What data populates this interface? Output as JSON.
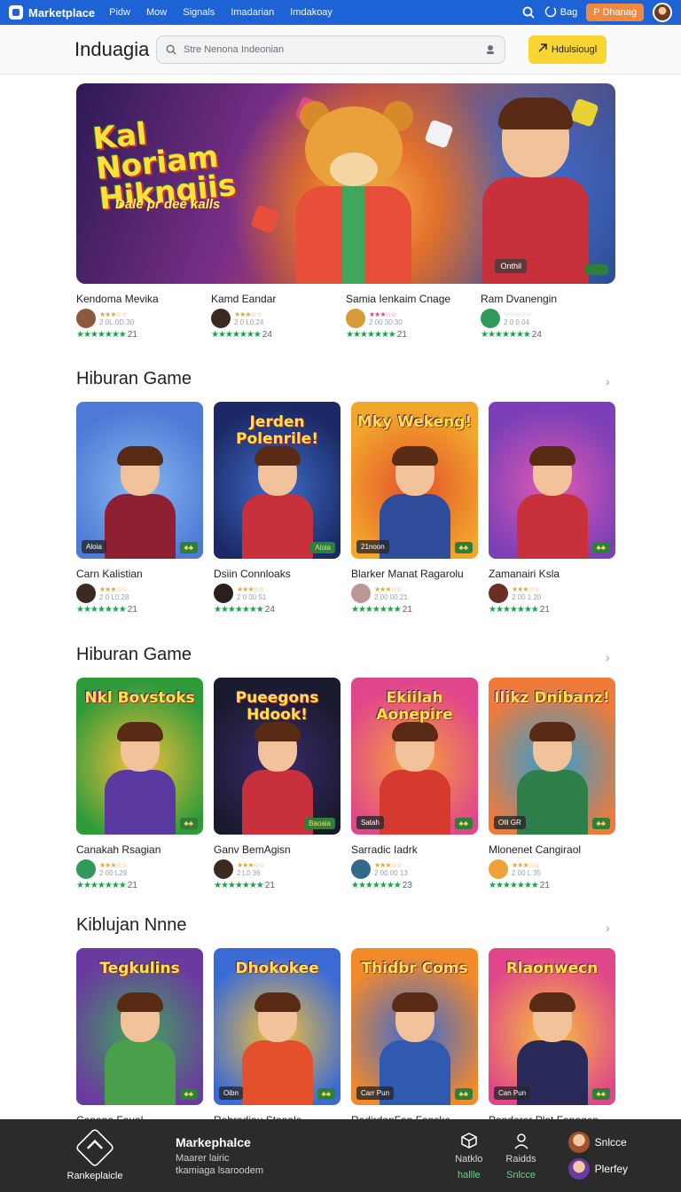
{
  "nav": {
    "brand": "Marketplace",
    "links": [
      "Pidw",
      "Mow",
      "Signals",
      "Imadarian",
      "Imdakoay"
    ],
    "bag_label": "Bag",
    "cta_label": "P Dhanag"
  },
  "header": {
    "title": "Induagia",
    "search_placeholder": "Stre Nenona Indeonian",
    "button_label": "Hdulsiougl"
  },
  "hero": {
    "title_line1": "Kal",
    "title_line2": "Noriam",
    "title_line3": "Hiknqiis",
    "subtitle": "Dale pr dee kalls",
    "tag": "Onthil"
  },
  "featured": [
    {
      "name": "Kendoma Mevika",
      "meta": "2 0L.0D.30",
      "count": "21",
      "avatar": "#8a5a3a"
    },
    {
      "name": "Kamd Eandar",
      "meta": "2 0 L0.24",
      "count": "24",
      "avatar": "#3b2a22"
    },
    {
      "name": "Samia Ienkaim Cnage",
      "meta": "2 00 30.30",
      "count": "21",
      "avatar": "#d89b3a"
    },
    {
      "name": "Ram Dvanengin",
      "meta": "2 0 0.04",
      "count": "24",
      "avatar": "#2f9a5a"
    }
  ],
  "sections": [
    {
      "title": "Hiburan Game",
      "cards": [
        {
          "name": "Carn Kalistian",
          "title": "",
          "badge_left": "Aloia",
          "badge_right": "",
          "meta": "2 0 L0.28",
          "count": "21",
          "bg1": "#4c7ad6",
          "bg2": "#89b8ef",
          "shirt": "#8f2033",
          "avatar": "#3b2a22"
        },
        {
          "name": "Dsiin Connloaks",
          "title": "Jerden Polenrile!",
          "badge_left": "",
          "badge_right": "Aloia",
          "meta": "2 0 00 51",
          "count": "24",
          "bg1": "#1b2a66",
          "bg2": "#3f6cc9",
          "shirt": "#c8313b",
          "avatar": "#2a1f1a"
        },
        {
          "name": "Blarker Manat Ragarolu",
          "title": "Mky Wekeng!",
          "badge_left": "21noon",
          "badge_right": "",
          "meta": "2 00 00.21",
          "count": "21",
          "bg1": "#f2a72c",
          "bg2": "#e4502b",
          "shirt": "#2f4c9a",
          "avatar": "#b99"
        },
        {
          "name": "Zamanairi Ksla",
          "title": "",
          "badge_left": "",
          "badge_right": "",
          "meta": "2 00 1 20",
          "count": "21",
          "bg1": "#7c3fb8",
          "bg2": "#e25ab0",
          "shirt": "#c8313b",
          "avatar": "#6a2f22"
        }
      ]
    },
    {
      "title": "Hiburan Game",
      "cards": [
        {
          "name": "Canakah Rsagian",
          "title": "Nkl Bovstoks",
          "badge_left": "",
          "badge_right": "",
          "meta": "2 00 L29",
          "count": "21",
          "bg1": "#2f9a3a",
          "bg2": "#f5c13a",
          "shirt": "#5a3aa0",
          "avatar": "#2f9a5a"
        },
        {
          "name": "Ganv BemAgisn",
          "title": "Pueegons Hdook!",
          "badge_left": "",
          "badge_right": "Baoaia",
          "meta": "2 L0 36",
          "count": "21",
          "bg1": "#1a1a2e",
          "bg2": "#3a2a6e",
          "shirt": "#c8313b",
          "avatar": "#3b2a22"
        },
        {
          "name": "Sarradic Iadrk",
          "title": "Ekiilah Aonepire",
          "badge_left": "Satah",
          "badge_right": "",
          "meta": "2 00 00 13",
          "count": "23",
          "bg1": "#e0468a",
          "bg2": "#f7a23a",
          "shirt": "#d63a2f",
          "avatar": "#2f6a8a"
        },
        {
          "name": "Mlonenet Cangiraol",
          "title": "Ilikz Dnibanz!",
          "badge_left": "Olil GR",
          "badge_right": "",
          "meta": "2 00 L 35",
          "count": "21",
          "bg1": "#f07a3a",
          "bg2": "#2aa0d6",
          "shirt": "#2f7f4a",
          "avatar": "#f0a03a"
        }
      ]
    },
    {
      "title": "Kiblujan Nnne",
      "cards": [
        {
          "name": "Canana Faual",
          "title": "Tegkulins",
          "badge_left": "",
          "badge_right": "",
          "meta": "",
          "count": "",
          "bg1": "#6a3aa0",
          "bg2": "#3fa65a",
          "shirt": "#4aa04a",
          "avatar": "#5a3a2a"
        },
        {
          "name": "Rohradiau Stanale",
          "title": "Dhokokee",
          "badge_left": "Oibn",
          "badge_right": "",
          "meta": "",
          "count": "",
          "bg1": "#3a6ad6",
          "bg2": "#f5c13a",
          "shirt": "#e4502b",
          "avatar": "#5a3a2a"
        },
        {
          "name": "RadirdanFan Fanske",
          "title": "Thidbr Coms",
          "badge_left": "Carr Pun",
          "badge_right": "",
          "meta": "",
          "count": "",
          "bg1": "#f28a2a",
          "bg2": "#3a6ad6",
          "shirt": "#2f5ab0",
          "avatar": "#5a3a2a"
        },
        {
          "name": "Panderer Plat Fanagen",
          "title": "Rlaonwecn",
          "badge_left": "Can Pun",
          "badge_right": "",
          "meta": "",
          "count": "",
          "bg1": "#e0468a",
          "bg2": "#f7c13a",
          "shirt": "#2a2a5a",
          "avatar": "#5a3a2a"
        }
      ]
    }
  ],
  "bottom": {
    "logo_label": "Rankeplaicle",
    "title": "Markephalce",
    "line1": "Maarer lairic",
    "line2": "tkamiaga lsaroodem",
    "items": [
      {
        "icon": "box-icon",
        "label": "Natklo",
        "sub": "hallle"
      },
      {
        "icon": "user-icon",
        "label": "Raidds",
        "sub": "Snlcce"
      }
    ],
    "profiles": [
      {
        "name": "Snlcce"
      },
      {
        "name": "Plerfey"
      }
    ]
  }
}
